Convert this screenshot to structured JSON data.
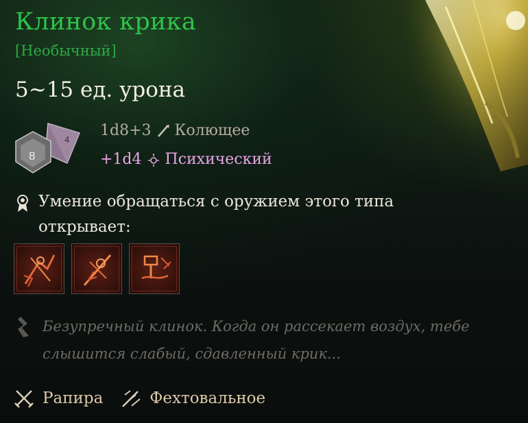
{
  "item": {
    "name": "Клинок крика",
    "rarity": "[Необычный]",
    "damage_range": "5~15 ед. урона"
  },
  "dice": {
    "big_die_label": "8",
    "small_die_label": "4"
  },
  "damage_lines": [
    {
      "dice": "1d8+3",
      "icon": "piercing-icon",
      "type": "Колющее",
      "color": "#b5ada1"
    },
    {
      "dice": "+1d4",
      "icon": "psychic-icon",
      "type": "Психический",
      "color": "#e7a6e8"
    }
  ],
  "proficiency": {
    "icon": "proficiency-icon",
    "text": "Умение обращаться с оружием этого типа открывает:"
  },
  "skills": [
    {
      "icon": "weapon-action-icon-1"
    },
    {
      "icon": "weapon-action-icon-2"
    },
    {
      "icon": "weapon-action-icon-3"
    }
  ],
  "lore": {
    "icon": "quote-icon",
    "text": "Безупречный клинок. Когда он рассекает воздух, тебе слышится слабый, сдавленный крик..."
  },
  "footer": {
    "weapon_type": "Рапира",
    "property": "Фехтовальное"
  },
  "colors": {
    "title": "#2fc24a",
    "rarity": "#2ea845",
    "lore": "#6f6b64",
    "footer": "#dcc9a8"
  }
}
